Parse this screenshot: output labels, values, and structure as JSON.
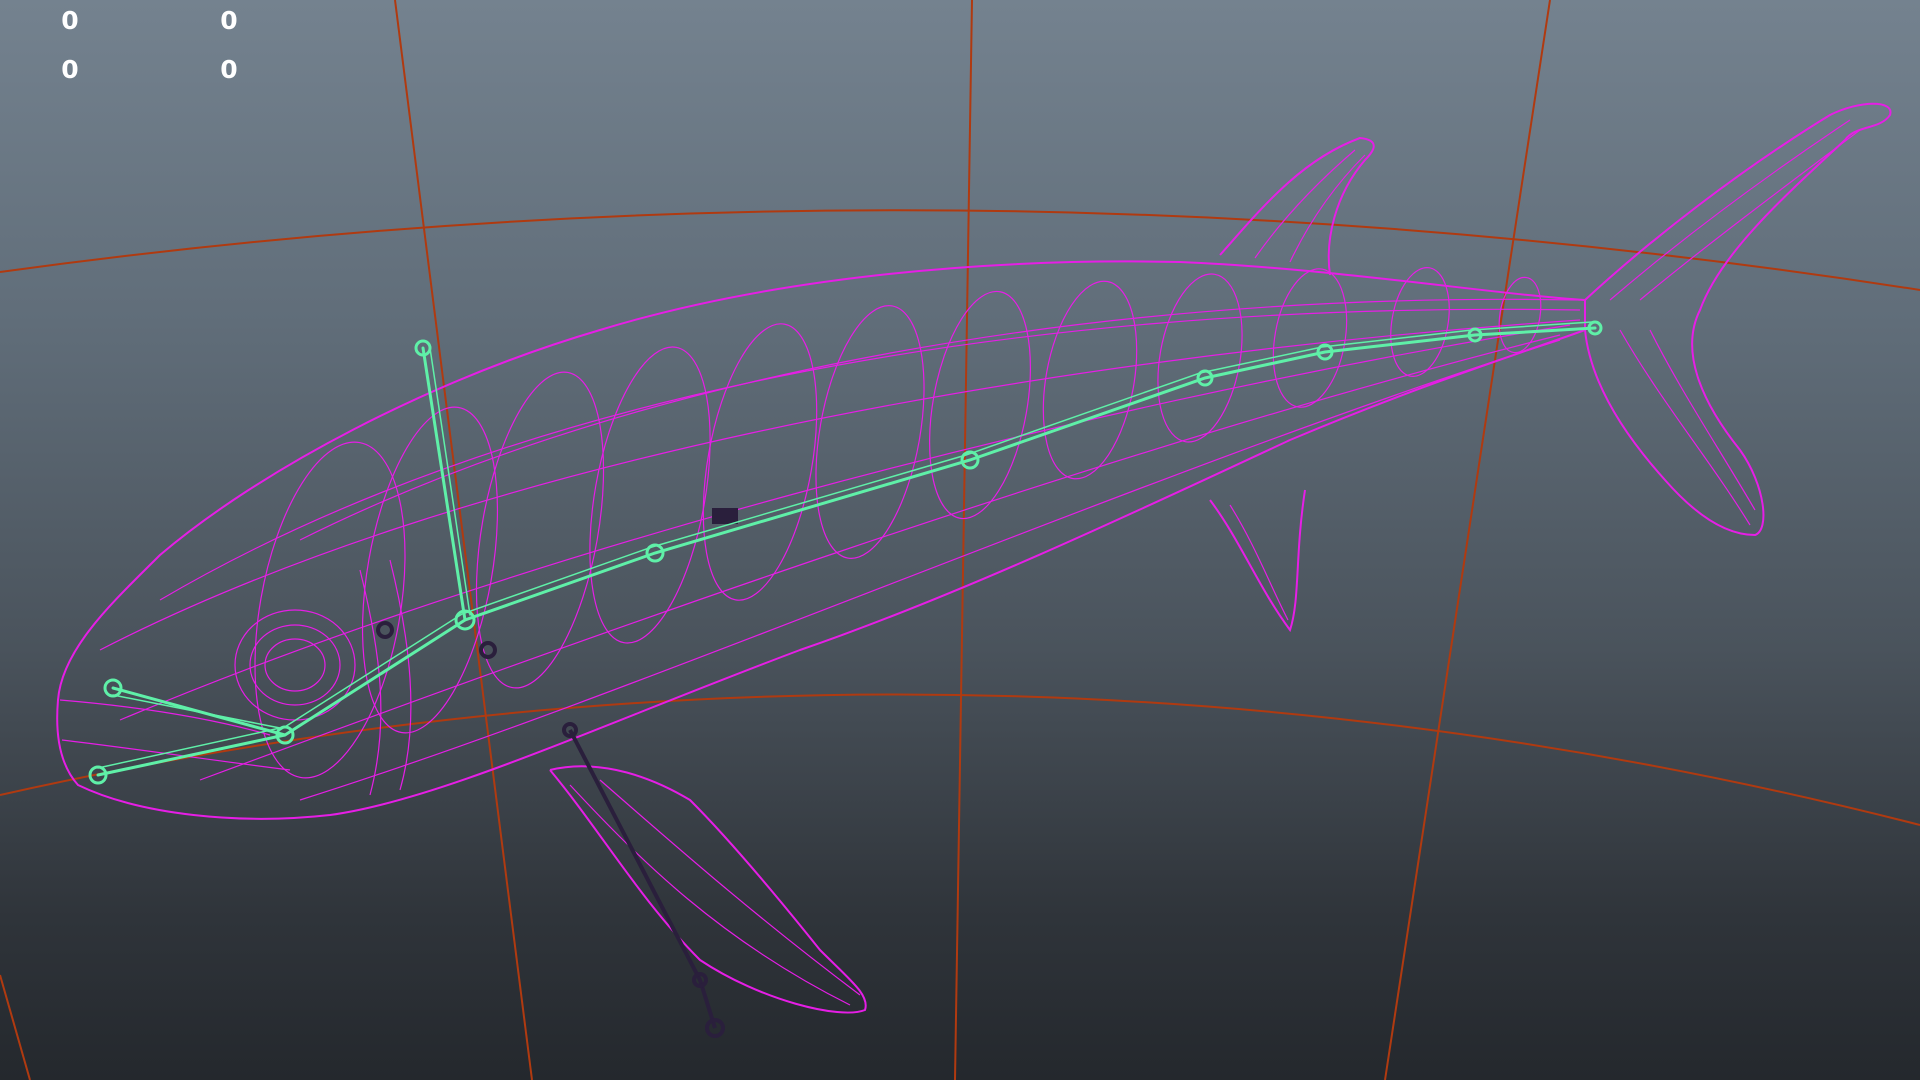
{
  "viewport": {
    "type": "3d-perspective-viewport",
    "display_mode": "wireframe",
    "background_gradient": [
      "#74828f",
      "#24282d"
    ]
  },
  "hud": {
    "values": [
      "0",
      "0",
      "0",
      "0"
    ]
  },
  "colors": {
    "grid": "#b03a10",
    "mesh_wireframe": "#e61ee6",
    "skeleton_selected": "#5ff0a8",
    "skeleton_unselected": "#2a1f3c",
    "hud_text": "#ffffff"
  },
  "scene": {
    "objects": [
      {
        "name": "fish-mesh",
        "kind": "polygon mesh",
        "icon": "wireframe-mesh"
      },
      {
        "name": "spine-joint-chain",
        "kind": "joint chain",
        "icon": "joint",
        "state": "selected"
      },
      {
        "name": "jaw-joint-chain",
        "kind": "joint chain",
        "icon": "joint",
        "state": "selected"
      },
      {
        "name": "dorsal-joint",
        "kind": "joint",
        "icon": "joint",
        "state": "selected"
      },
      {
        "name": "pectoral-fin-joint-chain",
        "kind": "joint chain",
        "icon": "joint",
        "state": "unselected"
      }
    ]
  }
}
